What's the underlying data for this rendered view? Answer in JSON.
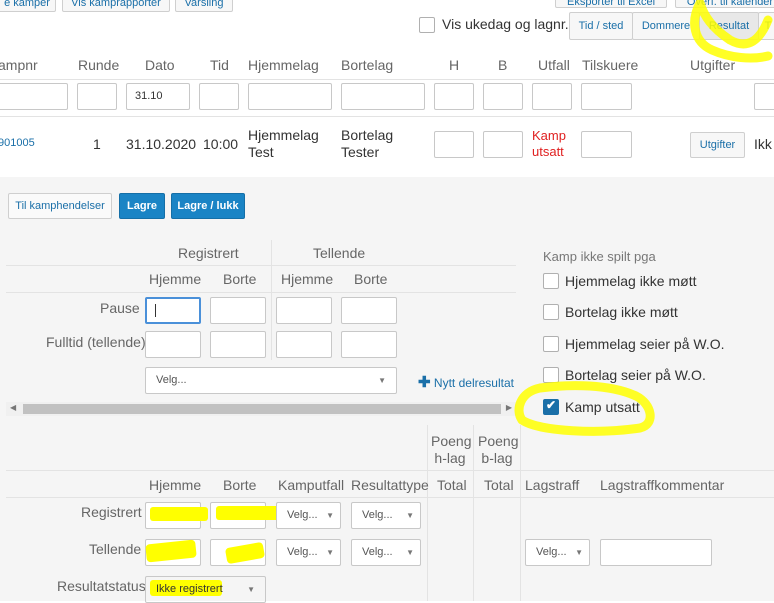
{
  "top_buttons": {
    "kamper": "e kamper",
    "kamprapporter": "Vis kamprapporter",
    "varsling": "Varsling",
    "eksport": "Eksporter til Excel",
    "kamp_til_kalender": "Overf. til kalender"
  },
  "vis_ukedag_label": "Vis ukedag og lagnr.",
  "view_tabs": [
    "Tid / sted",
    "Dommere",
    "Resultat"
  ],
  "match_table": {
    "headers": {
      "kampnr": "ampnr",
      "runde": "Runde",
      "dato": "Dato",
      "tid": "Tid",
      "hjemmelag": "Hjemmelag",
      "bortelag": "Bortelag",
      "h": "H",
      "b": "B",
      "utfall": "Utfall",
      "tilskuere": "Tilskuere",
      "utgifter": "Utgifter"
    },
    "filter_dato": "31.10",
    "row": {
      "kampnr": "901005",
      "runde": "1",
      "dato": "31.10.2020",
      "tid": "10:00",
      "hjemmelag_l1": "Hjemmelag",
      "hjemmelag_l2": "Test",
      "bortelag_l1": "Bortelag",
      "bortelag_l2": "Tester",
      "utfall_l1": "Kamp",
      "utfall_l2": "utsatt",
      "utgifter_button": "Utgifter",
      "extra": "Ikk"
    }
  },
  "action_buttons": {
    "kamphendelser": "Til kamphendelser",
    "lagre": "Lagre",
    "lagre_lukk": "Lagre / lukk"
  },
  "delresultat": {
    "registrert": "Registrert",
    "tellende": "Tellende",
    "hjemme": "Hjemme",
    "borte": "Borte",
    "pause": "Pause",
    "fulltid": "Fulltid (tellende)",
    "velg": "Velg...",
    "nytt_delresultat": "Nytt delresultat"
  },
  "kamp_ikke_spilt": {
    "title": "Kamp ikke spilt pga",
    "options": [
      {
        "label": "Hjemmelag ikke møtt",
        "checked": false
      },
      {
        "label": "Bortelag ikke møtt",
        "checked": false
      },
      {
        "label": "Hjemmelag seier på W.O.",
        "checked": false
      },
      {
        "label": "Bortelag seier på W.O.",
        "checked": false
      },
      {
        "label": "Kamp utsatt",
        "checked": true
      }
    ]
  },
  "result_table": {
    "headers": {
      "hjemme": "Hjemme",
      "borte": "Borte",
      "kamputfall": "Kamputfall",
      "resultattype": "Resultattype",
      "poeng_h_1": "Poeng",
      "poeng_h_2": "h-lag",
      "poeng_b_1": "Poeng",
      "poeng_b_2": "b-lag",
      "total": "Total",
      "lagstraff": "Lagstraff",
      "lagstraffkommentar": "Lagstraffkommentar"
    },
    "registrert": "Registrert",
    "tellende": "Tellende",
    "velg": "Velg...",
    "resultatstatus_label": "Resultatstatus",
    "resultatstatus_value": "Ikke registrert"
  },
  "colors": {
    "accent": "#1a84c5",
    "link": "#1a6fa8",
    "danger": "#e02020",
    "highlight": "#ffff00"
  }
}
